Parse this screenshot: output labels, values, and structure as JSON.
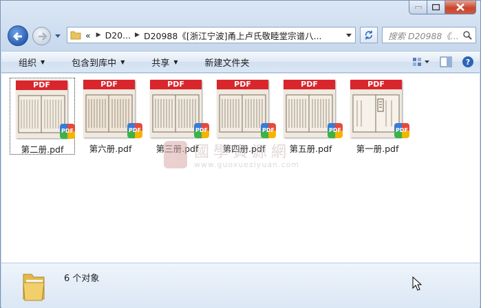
{
  "window": {
    "caption_buttons": [
      "minimize-icon",
      "maximize-icon",
      "close-icon"
    ]
  },
  "navigation": {
    "back_icon": "back-arrow-icon",
    "forward_icon": "forward-arrow-icon"
  },
  "address": {
    "prefix": "«",
    "crumb_1": "D20...",
    "crumb_2": "D20988《[浙江宁波]甬上卢氏敬睦堂宗谱八..."
  },
  "search": {
    "placeholder": "搜索 D20988《..."
  },
  "toolbar": {
    "organize": "组织",
    "include_in_library": "包含到库中",
    "share": "共享",
    "new_folder": "新建文件夹"
  },
  "files": [
    {
      "name": "第二册.pdf",
      "band": "PDF",
      "badge": "PDF",
      "selected": true
    },
    {
      "name": "第六册.pdf",
      "band": "PDF",
      "badge": "PDF"
    },
    {
      "name": "第三册.pdf",
      "band": "PDF",
      "badge": "PDF"
    },
    {
      "name": "第四册.pdf",
      "band": "PDF",
      "badge": "PDF"
    },
    {
      "name": "第五册.pdf",
      "band": "PDF",
      "badge": "PDF"
    },
    {
      "name": "第一册.pdf",
      "band": "PDF",
      "badge": "PDF"
    }
  ],
  "watermark": {
    "title": "國學資源網",
    "url": "www.guoxueziyuan.com"
  },
  "details": {
    "count_text": "6 个对象"
  },
  "colors": {
    "pdf_band": "#d9262c",
    "window_frame": "#c8d9ee"
  }
}
